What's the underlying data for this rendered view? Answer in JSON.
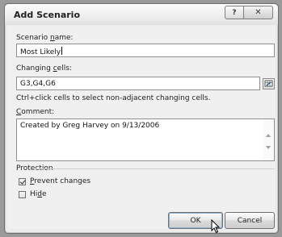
{
  "dialog": {
    "title": "Add Scenario",
    "help_glyph": "?",
    "close_glyph": "✕"
  },
  "scenario_name": {
    "label_pre": "Scenario ",
    "label_key": "n",
    "label_post": "ame:",
    "value": "Most Likely"
  },
  "changing_cells": {
    "label_pre": "Changing ",
    "label_key": "c",
    "label_post": "ells:",
    "value": "G3,G4,G6",
    "hint": "Ctrl+click cells to select non-adjacent changing cells."
  },
  "comment": {
    "label_pre": "",
    "label_key": "C",
    "label_post": "omment:",
    "value": "Created by Greg Harvey on 9/13/2006"
  },
  "protection": {
    "heading": "Protection",
    "prevent_changes": {
      "label_key": "P",
      "label_post": "revent changes",
      "checked": true
    },
    "hide": {
      "label_pre": "Hi",
      "label_key": "d",
      "label_post": "e",
      "checked": false
    }
  },
  "buttons": {
    "ok": "OK",
    "cancel": "Cancel"
  },
  "icons": {
    "collapse": "range-collapse-icon",
    "cursor": "mouse-pointer-icon"
  }
}
